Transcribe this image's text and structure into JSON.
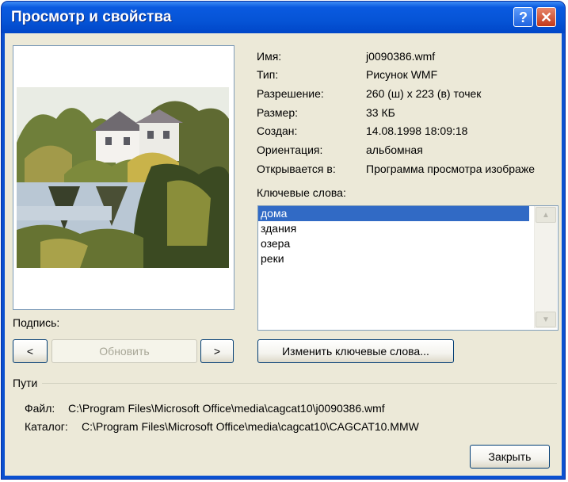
{
  "window": {
    "title": "Просмотр и свойства"
  },
  "titlebar_buttons": {
    "help": "?",
    "close": "✕"
  },
  "properties": [
    {
      "label": "Имя:",
      "value": "j0090386.wmf"
    },
    {
      "label": "Тип:",
      "value": "Рисунок WMF"
    },
    {
      "label": "Разрешение:",
      "value": "260 (ш) х 223 (в) точек"
    },
    {
      "label": "Размер:",
      "value": "33 КБ"
    },
    {
      "label": "Создан:",
      "value": "14.08.1998 18:09:18"
    },
    {
      "label": "Ориентация:",
      "value": "альбомная"
    },
    {
      "label": "Открывается в:",
      "value": "Программа просмотра изображе"
    }
  ],
  "keywords": {
    "label": "Ключевые слова:",
    "items": [
      "дома",
      "здания",
      "озера",
      "реки"
    ],
    "selected": "дома"
  },
  "caption_label": "Подпись:",
  "buttons": {
    "prev": "<",
    "refresh": "Обновить",
    "next": ">",
    "edit_keywords": "Изменить ключевые слова...",
    "close": "Закрыть"
  },
  "paths": {
    "header": "Пути",
    "file_label": "Файл:",
    "file_value": "C:\\Program Files\\Microsoft Office\\media\\cagcat10\\j0090386.wmf",
    "catalog_label": "Каталог:",
    "catalog_value": "C:\\Program Files\\Microsoft Office\\media\\cagcat10\\CAGCAT10.MMW"
  },
  "preview_image": "clipart-house-by-lake"
}
